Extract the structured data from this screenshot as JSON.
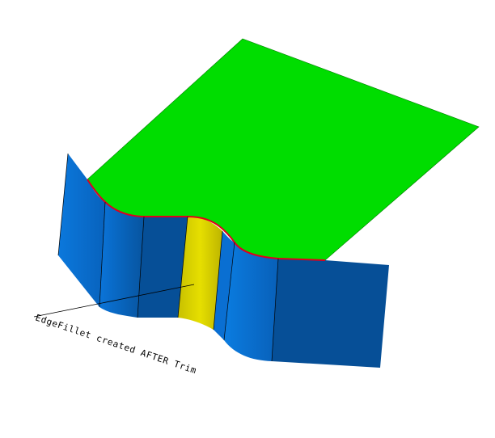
{
  "annotation": {
    "label": "EdgeFillet created AFTER Trim"
  },
  "colors": {
    "background": "#ffffff",
    "top_plane": "#00dd00",
    "wall_light": "#0a74d9",
    "wall_dark": "#064f97",
    "fillet_face": "#d4cc00",
    "trim_edge": "#e0001a",
    "edge_lines": "#000000"
  }
}
